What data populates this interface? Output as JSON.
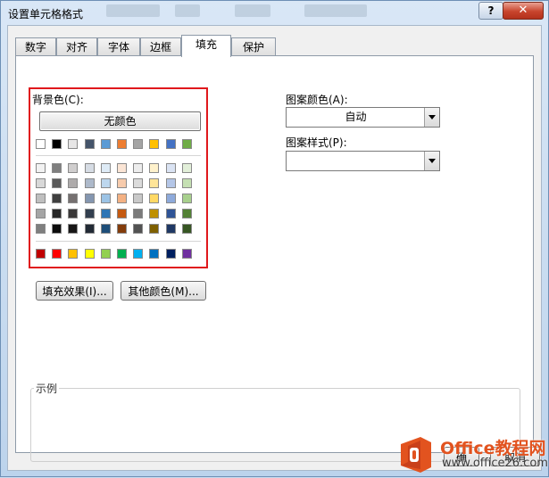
{
  "window": {
    "title": "设置单元格格式"
  },
  "tabs": [
    {
      "label": "数字"
    },
    {
      "label": "对齐"
    },
    {
      "label": "字体"
    },
    {
      "label": "边框"
    },
    {
      "label": "填充"
    },
    {
      "label": "保护"
    }
  ],
  "active_tab": "填充",
  "fill": {
    "background_label": "背景色(C):",
    "no_color_button": "无颜色",
    "theme_top_row": [
      "#ffffff",
      "#000000",
      "#e7e6e6",
      "#44546a",
      "#5b9bd5",
      "#ed7d31",
      "#a5a5a5",
      "#ffc000",
      "#4472c4",
      "#70ad47"
    ],
    "theme_shades": [
      [
        "#f2f2f2",
        "#7f7f7f",
        "#d0cece",
        "#d6dce4",
        "#deebf6",
        "#fbe5d5",
        "#ededed",
        "#fff2cc",
        "#dae3f3",
        "#e2efd9"
      ],
      [
        "#d8d8d8",
        "#595959",
        "#aeabab",
        "#adb9ca",
        "#bdd7ee",
        "#f7cbac",
        "#dbdbdb",
        "#fee599",
        "#b4c6e7",
        "#c5e0b3"
      ],
      [
        "#bfbfbf",
        "#3f3f3f",
        "#757070",
        "#8496b0",
        "#9cc3e5",
        "#f4b183",
        "#c9c9c9",
        "#ffd965",
        "#8eaadb",
        "#a8d08d"
      ],
      [
        "#a5a5a5",
        "#262626",
        "#3a3838",
        "#323f4f",
        "#2e75b5",
        "#c55a11",
        "#7b7b7b",
        "#bf9000",
        "#2f5496",
        "#538135"
      ],
      [
        "#7f7f7f",
        "#0c0c0c",
        "#171616",
        "#222a35",
        "#1e4e79",
        "#833c0b",
        "#525252",
        "#7f6000",
        "#1f3864",
        "#375623"
      ]
    ],
    "standard_colors": [
      "#c00000",
      "#ff0000",
      "#ffc000",
      "#ffff00",
      "#92d050",
      "#00b050",
      "#00b0f0",
      "#0070c0",
      "#002060",
      "#7030a0"
    ],
    "fill_effects_button": "填充效果(I)...",
    "more_colors_button": "其他颜色(M)...",
    "pattern_color_label": "图案颜色(A):",
    "pattern_color_value": "自动",
    "pattern_style_label": "图案样式(P):",
    "pattern_style_value": "",
    "sample_label": "示例"
  },
  "footer": {
    "ok_partial": "确",
    "cancel_partial": "取消"
  },
  "watermark": {
    "name": "Office教程网",
    "url": "www.office26.com"
  },
  "accent_colors": {
    "highlight_border": "#e0181c",
    "close_button": "#c8442c"
  }
}
